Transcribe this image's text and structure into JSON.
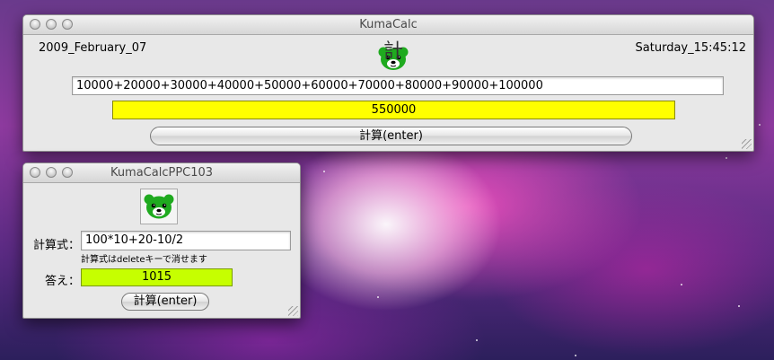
{
  "main_window": {
    "title": "KumaCalc",
    "date": "2009_February_07",
    "time": "Saturday_15:45:12",
    "icon_kanji": "計",
    "expression": "10000+20000+30000+40000+50000+60000+70000+80000+90000+100000",
    "result": "550000",
    "calc_button": "計算(enter)"
  },
  "small_window": {
    "title": "KumaCalcPPC103",
    "formula_label": "計算式：",
    "formula_value": "100*10+20-10/2",
    "hint": "計算式はdeleteキーで消せます",
    "answer_label": "答え：",
    "answer_value": "1015",
    "calc_button": "計算(enter)"
  },
  "colors": {
    "result_yellow": "#ffff00",
    "answer_lime": "#c6ff00",
    "bear_green": "#1faa1f"
  },
  "icons": [
    "close-icon",
    "minimize-icon",
    "zoom-icon",
    "bear-icon",
    "resize-grip-icon"
  ]
}
